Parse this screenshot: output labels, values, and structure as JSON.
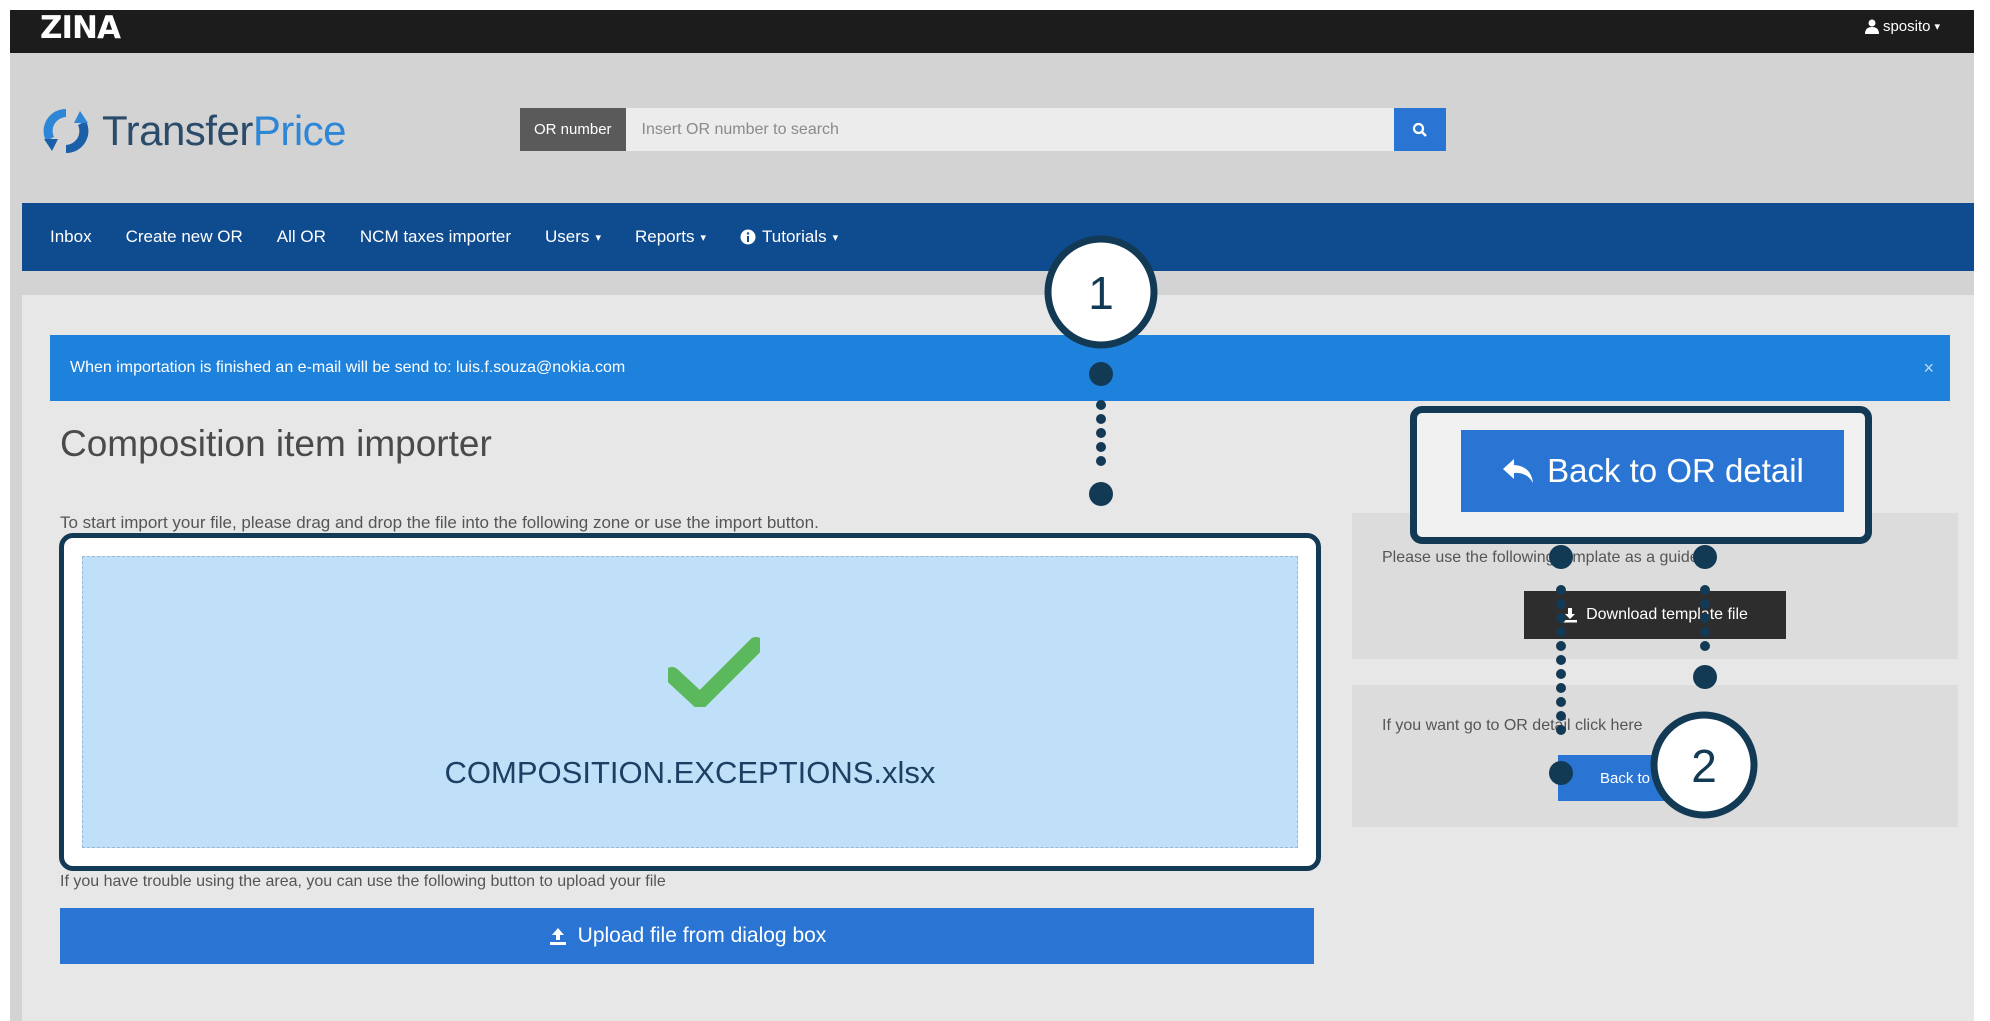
{
  "topbar": {
    "brand": "ZINA",
    "user": "sposito",
    "user_caret": "▾"
  },
  "header": {
    "logo_text_a": "Transfer",
    "logo_text_b": "Price",
    "search": {
      "label": "OR number",
      "placeholder": "Insert OR number to search"
    }
  },
  "nav": {
    "items": [
      {
        "label": "Inbox"
      },
      {
        "label": "Create new OR"
      },
      {
        "label": "All OR"
      },
      {
        "label": "NCM taxes importer"
      },
      {
        "label": "Users",
        "caret": "▾"
      },
      {
        "label": "Reports",
        "caret": "▾"
      },
      {
        "label": "Tutorials",
        "caret": "▾"
      }
    ]
  },
  "alert": {
    "text": "When importation is finished an e-mail will be send to: luis.f.souza@nokia.com",
    "close": "×"
  },
  "page": {
    "title": "Composition item importer",
    "instructions": "To start import your file, please drag and drop the file into the following zone or use the import button.",
    "dropzone": {
      "file_name": "COMPOSITION.EXCEPTIONS.xlsx"
    },
    "trouble_text": "If you have trouble using the area, you can use the following button to upload your file",
    "upload_button": "Upload file from dialog box"
  },
  "sidebar": {
    "template_text": "Please use the following template as a guide",
    "download_button": "Download template file",
    "ordetail_text": "If you want go to OR detail click here",
    "back_button_small": "Back to OR detail"
  },
  "callouts": {
    "back_button_big": "Back to OR detail",
    "step1": "1",
    "step2": "2"
  },
  "colors": {
    "navbar": "#0f4b8f",
    "accent": "#2a75d3",
    "alert": "#1e82dc",
    "callout_border": "#133a55",
    "success": "#5cb85c"
  }
}
